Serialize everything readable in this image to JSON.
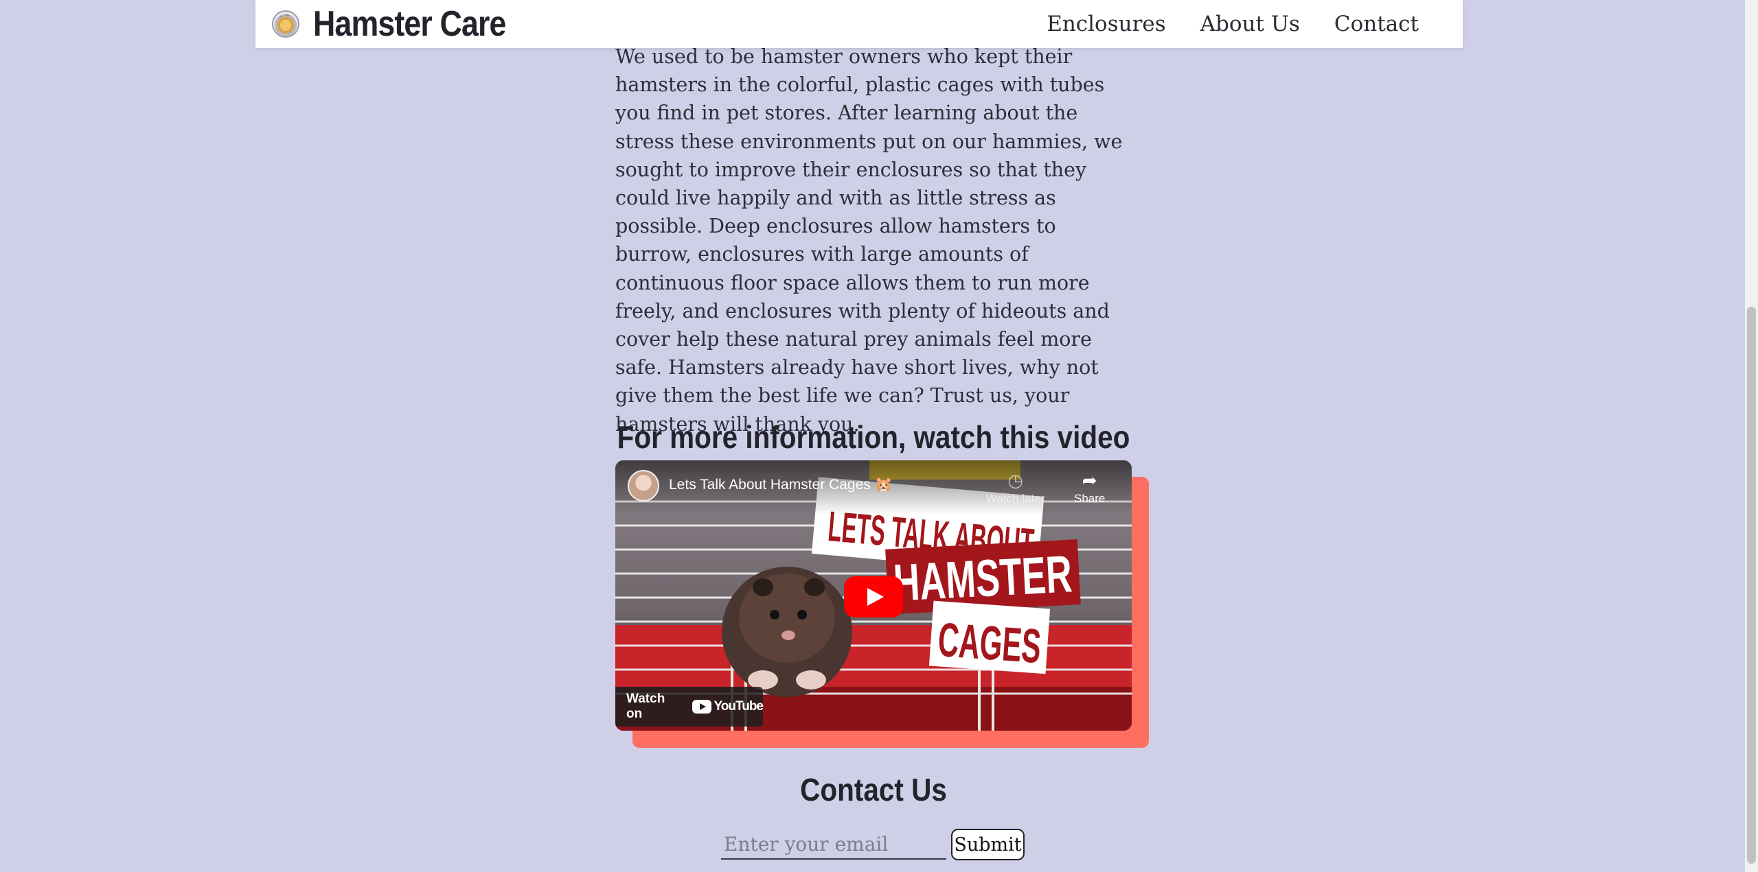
{
  "nav": {
    "title": "Hamster Care",
    "links": [
      "Enclosures",
      "About Us",
      "Contact"
    ]
  },
  "about": {
    "paragraph": "We used to be hamster owners who kept their hamsters in the colorful, plastic cages with tubes you find in pet stores. After learning about the stress these environments put on our hammies, we sought to improve their enclosures so that they could live happily and with as little stress as possible. Deep enclosures allow hamsters to burrow, enclosures with large amounts of continuous floor space allows them to run more freely, and enclosures with plenty of hideouts and cover help these natural prey animals feel more safe. Hamsters already have short lives, why not give them the best life we can? Trust us, your hamsters will thank you."
  },
  "video": {
    "heading": "For more information, watch this video",
    "title": "Lets Talk About Hamster Cages 🐹",
    "watch_later_label": "Watch later",
    "share_label": "Share",
    "watch_on_label": "Watch on",
    "youtube_label": "YouTube",
    "thumbnail_text": [
      "LETS TALK ABOUT",
      "HAMSTER",
      "CAGES"
    ]
  },
  "contact": {
    "heading": "Contact Us",
    "email_placeholder": "Enter your email",
    "submit_label": "Submit"
  },
  "colors": {
    "background": "#cfcfe8",
    "accent_shadow": "#ff6f61",
    "youtube_red": "#ff0000"
  }
}
